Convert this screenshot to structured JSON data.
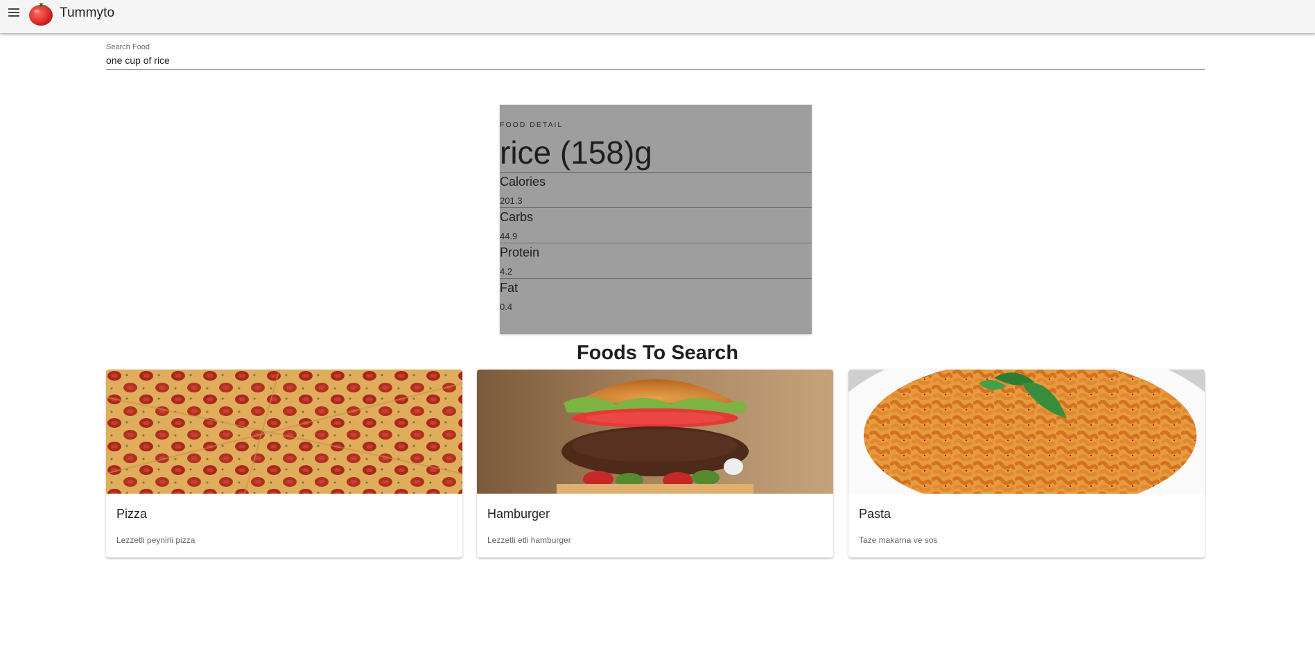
{
  "app": {
    "title": "Tummyto",
    "logo_icon": "tomato-icon",
    "menu_icon": "menu-icon"
  },
  "search": {
    "label": "Search Food",
    "value": "one cup of rice"
  },
  "food_detail": {
    "overline": "FOOD DETAIL",
    "title": "rice (158)g",
    "nutrients": [
      {
        "name": "Calories",
        "value": "201.3"
      },
      {
        "name": "Carbs",
        "value": "44.9"
      },
      {
        "name": "Protein",
        "value": "4.2"
      },
      {
        "name": "Fat",
        "value": "0.4"
      }
    ]
  },
  "foods_section": {
    "heading": "Foods To Search",
    "cards": [
      {
        "title": "Pizza",
        "description": "Lezzetli peynirli pizza"
      },
      {
        "title": "Hamburger",
        "description": "Lezzetli etli hamburger"
      },
      {
        "title": "Pasta",
        "description": "Taze makarna ve sos"
      }
    ]
  },
  "colors": {
    "appbar_bg": "#f5f5f5",
    "detail_card_bg": "#9e9e9e",
    "tomato_red": "#e53935"
  }
}
